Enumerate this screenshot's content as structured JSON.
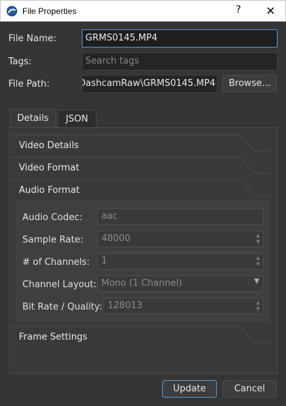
{
  "window": {
    "title": "File Properties",
    "help_glyph": "?",
    "close_glyph": "✕"
  },
  "form": {
    "file_name_label": "File Name:",
    "file_name_value": "GRMS0145.MP4",
    "tags_label": "Tags:",
    "tags_placeholder": "Search tags",
    "file_path_label": "File Path:",
    "file_path_value": "DashcamRaw\\GRMS0145.MP4",
    "browse_label": "Browse..."
  },
  "tabs": [
    {
      "label": "Details",
      "active": true
    },
    {
      "label": "JSON",
      "active": false
    }
  ],
  "sections": [
    {
      "label": "Video Details",
      "expanded": false
    },
    {
      "label": "Video Format",
      "expanded": false
    },
    {
      "label": "Audio Format",
      "expanded": true
    },
    {
      "label": "Frame Settings",
      "expanded": false
    }
  ],
  "audio": {
    "codec_label": "Audio Codec:",
    "codec_value": "aac",
    "sample_rate_label": "Sample Rate:",
    "sample_rate_value": "48000",
    "channels_label": "# of Channels:",
    "channels_value": "1",
    "layout_label": "Channel Layout:",
    "layout_value": "Mono (1 Channel)",
    "bitrate_label": "Bit Rate / Quality:",
    "bitrate_value": "128013"
  },
  "footer": {
    "update_label": "Update",
    "cancel_label": "Cancel"
  },
  "colors": {
    "background": "#353535",
    "focus_accent": "#5a9bd5",
    "input_bg": "#252525"
  }
}
